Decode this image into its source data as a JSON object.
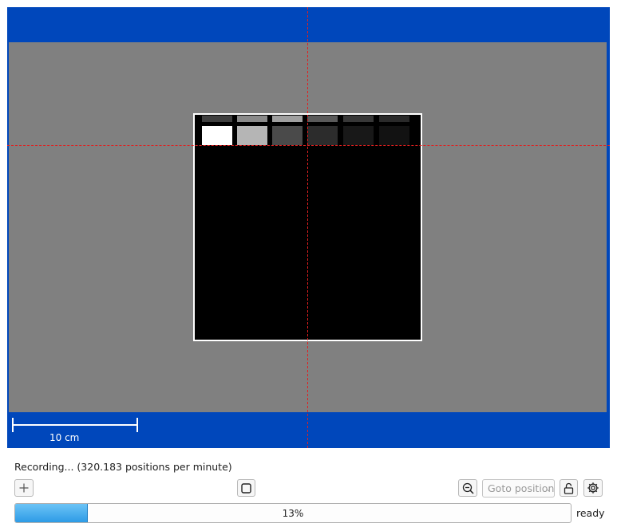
{
  "viewer": {
    "frame_color": "#0047bb",
    "background_color": "#808080",
    "crosshair_color": "#e02020",
    "scale_label": "10 cm",
    "scan_rows": [
      [
        {
          "shade": "#404040"
        },
        {
          "shade": "#8a8a8a"
        },
        {
          "shade": "#a0a0a0"
        },
        {
          "shade": "#5a5a5a"
        },
        {
          "shade": "#383838"
        },
        {
          "shade": "#2a2a2a"
        }
      ],
      [
        {
          "shade": "#ffffff"
        },
        {
          "shade": "#b5b5b5"
        },
        {
          "shade": "#4a4a4a"
        },
        {
          "shade": "#2c2c2c"
        },
        {
          "shade": "#181818"
        },
        {
          "shade": "#121212"
        }
      ]
    ]
  },
  "status": {
    "recording_text": "Recording... (320.183 positions per minute)",
    "ready_text": "ready"
  },
  "toolbar": {
    "add_icon": "plus-icon",
    "stop_icon": "square-icon",
    "zoom_out_icon": "zoom-out-icon",
    "goto_placeholder": "Goto position",
    "lock_icon": "lock-icon",
    "settings_icon": "gear-icon"
  },
  "progress": {
    "value": 0.13,
    "label": "13%"
  }
}
